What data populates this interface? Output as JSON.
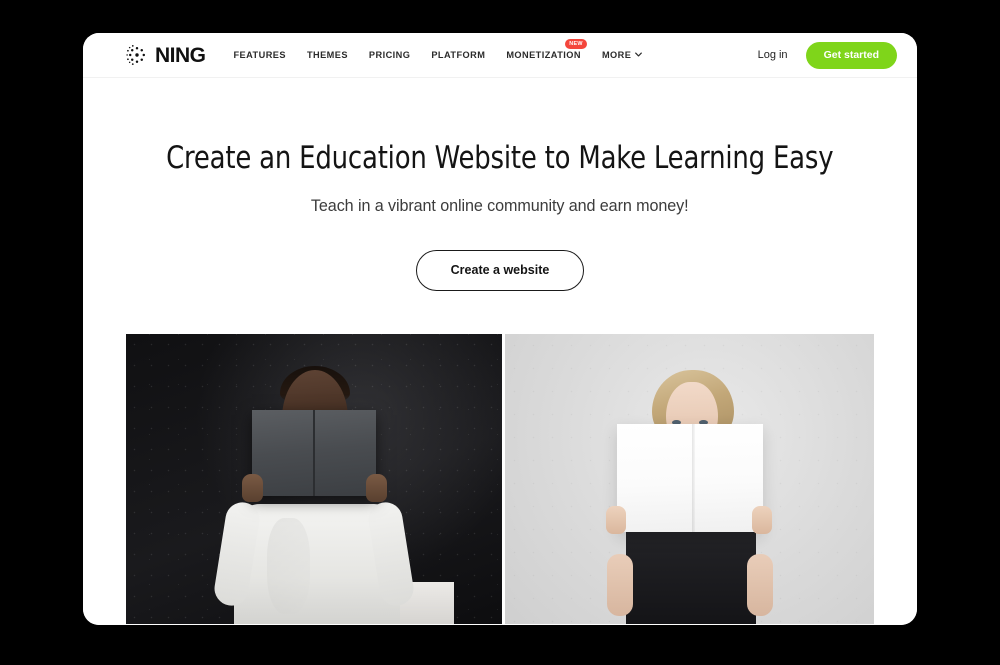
{
  "theme": {
    "page_background": "#000000",
    "card_background": "#ffffff",
    "accent_green": "#7fd51a",
    "badge_red": "#f4463c",
    "text_dark": "#141414"
  },
  "header": {
    "brand": {
      "mark_icon": "ning-dot-circle-logo",
      "wordmark": "NING"
    },
    "nav_items": [
      {
        "label": "FEATURES",
        "badge": null,
        "has_dropdown": false
      },
      {
        "label": "THEMES",
        "badge": null,
        "has_dropdown": false
      },
      {
        "label": "PRICING",
        "badge": null,
        "has_dropdown": false
      },
      {
        "label": "PLATFORM",
        "badge": null,
        "has_dropdown": false
      },
      {
        "label": "MONETIZATION",
        "badge": "NEW",
        "has_dropdown": false
      },
      {
        "label": "MORE",
        "badge": null,
        "has_dropdown": true
      }
    ],
    "login_label": "Log in",
    "get_started_label": "Get started",
    "chevron_icon": "chevron-down-icon"
  },
  "hero": {
    "title": "Create an Education Website to Make Learning Easy",
    "subtitle": "Teach in a vibrant online community and earn money!",
    "cta_label": "Create a website",
    "media": [
      {
        "name": "photo-man-dark-book",
        "alt": "Man in white shirt holding an open dark grey book over his face against a black background"
      },
      {
        "name": "photo-woman-white-book",
        "alt": "Blonde woman in a black top holding an open white book over her face against a light grey background"
      }
    ]
  }
}
